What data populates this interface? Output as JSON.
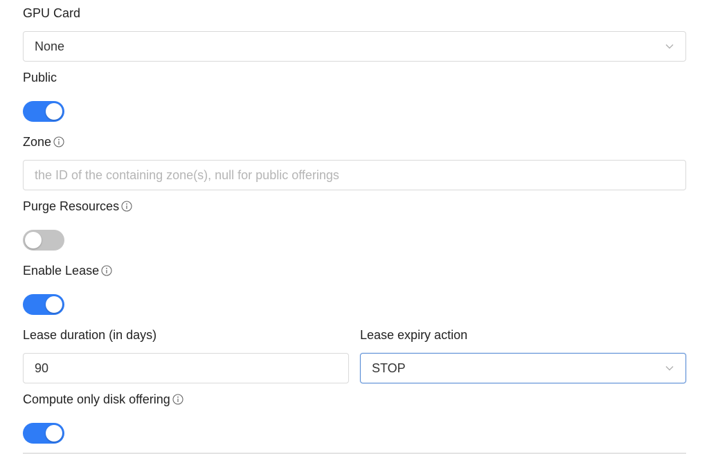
{
  "gpu_card": {
    "label": "GPU Card",
    "value": "None"
  },
  "public": {
    "label": "Public",
    "enabled": true
  },
  "zone": {
    "label": "Zone",
    "placeholder": "the ID of the containing zone(s), null for public offerings",
    "value": ""
  },
  "purge_resources": {
    "label": "Purge Resources",
    "enabled": false
  },
  "enable_lease": {
    "label": "Enable Lease",
    "enabled": true
  },
  "lease_duration": {
    "label": "Lease duration (in days)",
    "value": "90"
  },
  "lease_expiry_action": {
    "label": "Lease expiry action",
    "value": "STOP"
  },
  "compute_only_disk_offering": {
    "label": "Compute only disk offering",
    "enabled": true
  },
  "colors": {
    "toggle_on": "#2f7cf6",
    "toggle_off": "#c4c4c4",
    "focus_border": "#5b8fd6"
  },
  "icons": [
    "info-icon",
    "chevron-down-icon"
  ]
}
